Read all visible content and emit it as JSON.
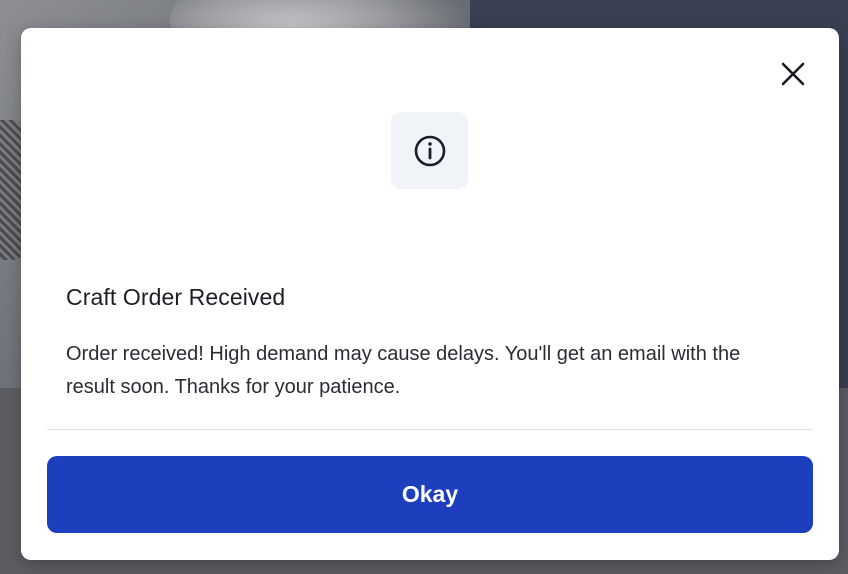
{
  "dialog": {
    "title": "Craft Order Received",
    "message": "Order received! High demand may cause delays. You'll get an email with the result soon. Thanks for your patience.",
    "ok_label": "Okay",
    "info_icon": "info-circle-icon",
    "close_icon": "close-icon"
  },
  "colors": {
    "primary_button": "#1d3ebd",
    "icon_tile_bg": "#f0f3f8",
    "backdrop": "#3a3f52"
  }
}
